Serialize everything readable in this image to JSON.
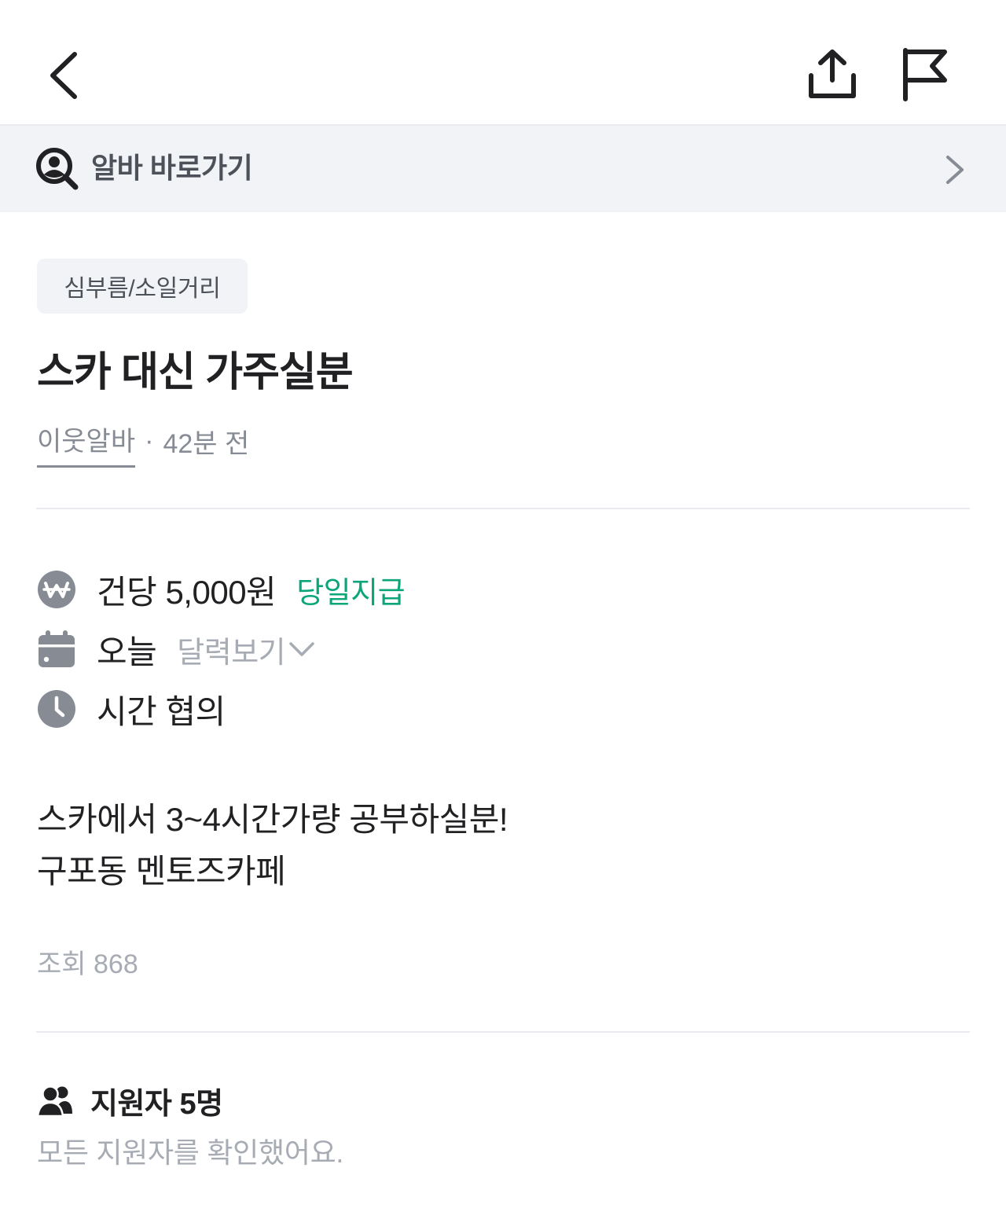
{
  "header": {
    "back_icon": "chevron-left-icon",
    "share_icon": "share-upload-icon",
    "report_icon": "flag-icon"
  },
  "shortcut": {
    "label": "알바 바로가기",
    "icon": "person-search-icon",
    "chevron_icon": "chevron-right-icon"
  },
  "post": {
    "category": "심부름/소일거리",
    "title": "스카 대신 가주실분",
    "poster": "이웃알바",
    "separator": "·",
    "time_ago": "42분 전"
  },
  "details": {
    "wage": "건당 5,000원",
    "pay_timing": "당일지급",
    "date": "오늘",
    "calendar_link": "달력보기",
    "time": "시간 협의"
  },
  "description": {
    "lines": [
      "스카에서 3~4시간가량 공부하실분!",
      "구포동 멘토즈카페"
    ]
  },
  "stats": {
    "views": "조회 868"
  },
  "applicants": {
    "title": "지원자 5명",
    "status": "모든 지원자를 확인했어요."
  },
  "colors": {
    "accent_green": "#0aa679",
    "icon_gray": "#868b94",
    "text_primary": "#212124",
    "text_muted": "#a7abb3",
    "surface_gray": "#f2f3f6"
  }
}
